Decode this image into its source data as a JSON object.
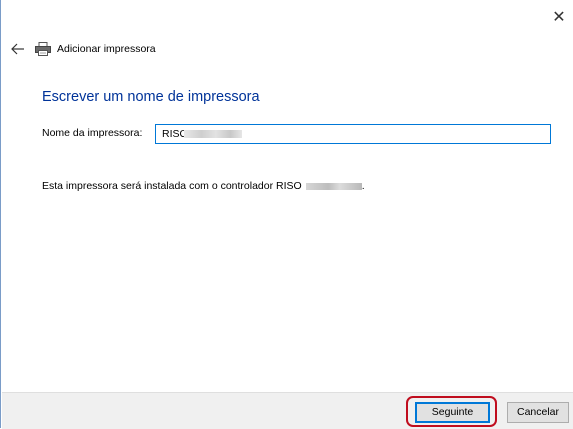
{
  "window": {
    "close_glyph": "✕"
  },
  "nav": {
    "back_icon": "back-arrow-icon",
    "printer_icon": "printer-icon",
    "title": "Adicionar impressora"
  },
  "main": {
    "heading": "Escrever um nome de impressora",
    "name_label": "Nome da impressora:",
    "name_value": "RISO",
    "info_text": "Esta impressora será instalada com o controlador RISO",
    "info_suffix": "."
  },
  "footer": {
    "next_label": "Seguinte",
    "cancel_label": "Cancelar"
  },
  "colors": {
    "heading": "#003399",
    "focus_border": "#0078d7",
    "highlight": "#c00d1e",
    "footer_bg": "#f0f0f0"
  }
}
